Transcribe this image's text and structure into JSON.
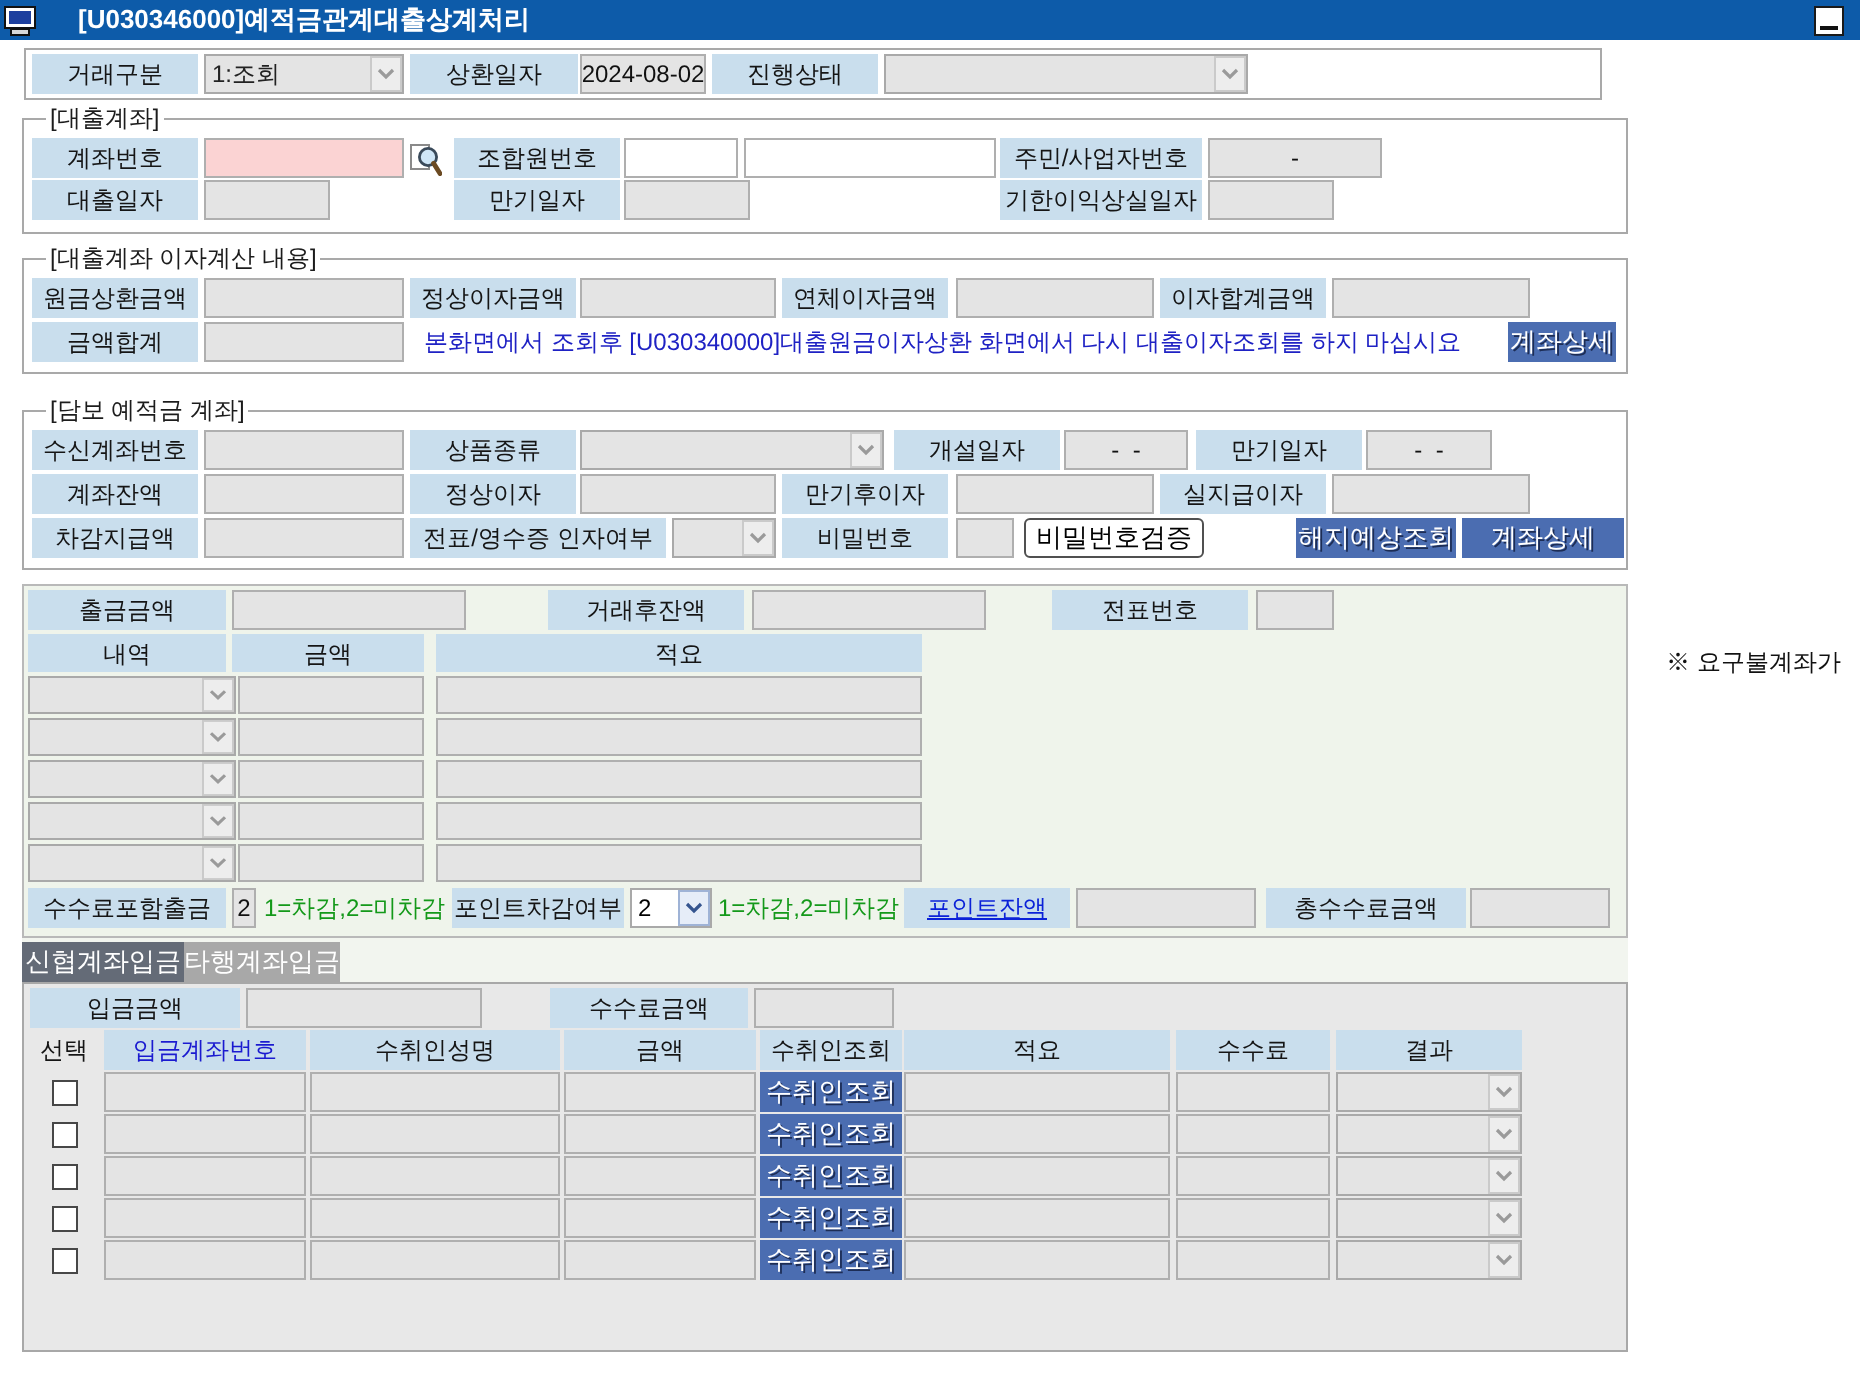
{
  "window": {
    "title": "[U030346000]예적금관계대출상계처리"
  },
  "transaction": [
    {
      "kind": "label",
      "text": "거래구분"
    },
    {
      "kind": "select",
      "disabled": true,
      "value": "1:조회"
    },
    {
      "kind": "label",
      "text": "상환일자"
    },
    {
      "kind": "field",
      "value": "2024-08-02"
    },
    {
      "kind": "label",
      "text": "진행상태"
    },
    {
      "kind": "select",
      "disabled": true
    }
  ],
  "loan_account": {
    "title": "[대출계좌]",
    "rows": [
      [
        {
          "kind": "label",
          "text": "계좌번호"
        },
        {
          "kind": "required"
        },
        {
          "kind": "lookup"
        },
        {
          "kind": "label",
          "text": "조합원번호"
        },
        {
          "kind": "input"
        },
        {
          "kind": "input"
        },
        {
          "kind": "label",
          "text": "주민/사업자번호"
        },
        {
          "kind": "field",
          "value": "-"
        }
      ],
      [
        {
          "kind": "label",
          "text": "대출일자"
        },
        {
          "kind": "field"
        },
        {
          "kind": "label",
          "text": "만기일자"
        },
        {
          "kind": "field"
        },
        {
          "kind": "label",
          "text": "기한이익상실일자"
        },
        {
          "kind": "field"
        }
      ]
    ]
  },
  "interest": {
    "title": "[대출계좌 이자계산 내용]",
    "rows": [
      [
        {
          "kind": "label",
          "text": "원금상환금액"
        },
        {
          "kind": "field"
        },
        {
          "kind": "label",
          "text": "정상이자금액"
        },
        {
          "kind": "field"
        },
        {
          "kind": "label",
          "text": "연체이자금액"
        },
        {
          "kind": "field"
        },
        {
          "kind": "label",
          "text": "이자합계금액"
        },
        {
          "kind": "field"
        }
      ],
      [
        {
          "kind": "label",
          "text": "금액합계"
        },
        {
          "kind": "field"
        },
        {
          "kind": "notice",
          "text": "본화면에서 조회후 [U030340000]대출원금이자상환 화면에서 다시 대출이자조회를 하지 마십시요"
        },
        {
          "kind": "button",
          "text": "계좌상세"
        }
      ]
    ]
  },
  "collateral": {
    "title": "[담보 예적금 계좌]",
    "rows": [
      [
        {
          "kind": "label",
          "text": "수신계좌번호"
        },
        {
          "kind": "field"
        },
        {
          "kind": "label",
          "text": "상품종류"
        },
        {
          "kind": "select",
          "disabled": true
        },
        {
          "kind": "label",
          "text": "개설일자"
        },
        {
          "kind": "field",
          "value": "-  -"
        },
        {
          "kind": "label",
          "text": "만기일자"
        },
        {
          "kind": "field",
          "value": "-  -"
        }
      ],
      [
        {
          "kind": "label",
          "text": "계좌잔액"
        },
        {
          "kind": "field"
        },
        {
          "kind": "label",
          "text": "정상이자"
        },
        {
          "kind": "field"
        },
        {
          "kind": "label",
          "text": "만기후이자"
        },
        {
          "kind": "field"
        },
        {
          "kind": "label",
          "text": "실지급이자"
        },
        {
          "kind": "field"
        }
      ],
      [
        {
          "kind": "label",
          "text": "차감지급액"
        },
        {
          "kind": "field"
        },
        {
          "kind": "label",
          "text": "전표/영수증 인자여부"
        },
        {
          "kind": "select",
          "disabled": true
        },
        {
          "kind": "label",
          "text": "비밀번호"
        },
        {
          "kind": "field"
        }
      ]
    ],
    "actions": [
      {
        "kind": "outline",
        "text": "비밀번호검증"
      },
      {
        "kind": "button",
        "text": "해지예상조회"
      },
      {
        "kind": "button",
        "text": "계좌상세"
      }
    ]
  },
  "withdrawal": {
    "top": [
      {
        "kind": "label",
        "text": "출금금액"
      },
      {
        "kind": "field"
      },
      {
        "kind": "label",
        "text": "거래후잔액"
      },
      {
        "kind": "field"
      },
      {
        "kind": "label",
        "text": "전표번호"
      },
      {
        "kind": "field"
      }
    ],
    "header": [
      {
        "kind": "label",
        "text": "내역"
      },
      {
        "kind": "label",
        "text": "금액"
      },
      {
        "kind": "label",
        "text": "적요"
      }
    ],
    "lines": [
      [
        {
          "kind": "select",
          "disabled": true
        },
        {
          "kind": "field"
        },
        {
          "kind": "field"
        }
      ],
      [
        {
          "kind": "select",
          "disabled": true
        },
        {
          "kind": "field"
        },
        {
          "kind": "field"
        }
      ],
      [
        {
          "kind": "select",
          "disabled": true
        },
        {
          "kind": "field"
        },
        {
          "kind": "field"
        }
      ],
      [
        {
          "kind": "select",
          "disabled": true
        },
        {
          "kind": "field"
        },
        {
          "kind": "field"
        }
      ],
      [
        {
          "kind": "select",
          "disabled": true
        },
        {
          "kind": "field"
        },
        {
          "kind": "field"
        }
      ]
    ],
    "footer": [
      {
        "kind": "label",
        "text": "수수료포함출금"
      },
      {
        "kind": "field",
        "value": "2"
      },
      {
        "kind": "hint",
        "text": "1=차감,2=미차감"
      },
      {
        "kind": "label",
        "text": "포인트차감여부"
      },
      {
        "kind": "select",
        "disabled": false,
        "value": "2"
      },
      {
        "kind": "hint",
        "text": "1=차감,2=미차감"
      },
      {
        "kind": "link",
        "text": "포인트잔액"
      },
      {
        "kind": "field"
      },
      {
        "kind": "label",
        "text": "총수수료금액"
      },
      {
        "kind": "field"
      }
    ]
  },
  "side_note": {
    "text": "※ 요구불계좌가"
  },
  "tabs": [
    {
      "label": "신협계좌입금",
      "selected": true
    },
    {
      "label": "타행계좌입금",
      "selected": false
    }
  ],
  "deposit": {
    "top": [
      {
        "kind": "label",
        "text": "입금금액"
      },
      {
        "kind": "field"
      },
      {
        "kind": "label",
        "text": "수수료금액"
      },
      {
        "kind": "field"
      }
    ],
    "header": [
      {
        "kind": "plain",
        "text": "선택"
      },
      {
        "kind": "key",
        "text": "입금계좌번호"
      },
      {
        "kind": "label",
        "text": "수취인성명"
      },
      {
        "kind": "label",
        "text": "금액"
      },
      {
        "kind": "label",
        "text": "수취인조회"
      },
      {
        "kind": "label",
        "text": "적요"
      },
      {
        "kind": "label",
        "text": "수수료"
      },
      {
        "kind": "label",
        "text": "결과"
      }
    ],
    "lines": [
      [
        {
          "kind": "checkbox",
          "checked": false
        },
        {
          "kind": "field"
        },
        {
          "kind": "field"
        },
        {
          "kind": "field"
        },
        {
          "kind": "button",
          "text": "수취인조회"
        },
        {
          "kind": "field"
        },
        {
          "kind": "field"
        },
        {
          "kind": "select",
          "disabled": true
        }
      ],
      [
        {
          "kind": "checkbox",
          "checked": false
        },
        {
          "kind": "field"
        },
        {
          "kind": "field"
        },
        {
          "kind": "field"
        },
        {
          "kind": "button",
          "text": "수취인조회"
        },
        {
          "kind": "field"
        },
        {
          "kind": "field"
        },
        {
          "kind": "select",
          "disabled": true
        }
      ],
      [
        {
          "kind": "checkbox",
          "checked": false
        },
        {
          "kind": "field"
        },
        {
          "kind": "field"
        },
        {
          "kind": "field"
        },
        {
          "kind": "button",
          "text": "수취인조회"
        },
        {
          "kind": "field"
        },
        {
          "kind": "field"
        },
        {
          "kind": "select",
          "disabled": true
        }
      ],
      [
        {
          "kind": "checkbox",
          "checked": false
        },
        {
          "kind": "field"
        },
        {
          "kind": "field"
        },
        {
          "kind": "field"
        },
        {
          "kind": "button",
          "text": "수취인조회"
        },
        {
          "kind": "field"
        },
        {
          "kind": "field"
        },
        {
          "kind": "select",
          "disabled": true
        }
      ],
      [
        {
          "kind": "checkbox",
          "checked": false
        },
        {
          "kind": "field"
        },
        {
          "kind": "field"
        },
        {
          "kind": "field"
        },
        {
          "kind": "button",
          "text": "수취인조회"
        },
        {
          "kind": "field"
        },
        {
          "kind": "field"
        },
        {
          "kind": "select",
          "disabled": true
        }
      ]
    ]
  }
}
